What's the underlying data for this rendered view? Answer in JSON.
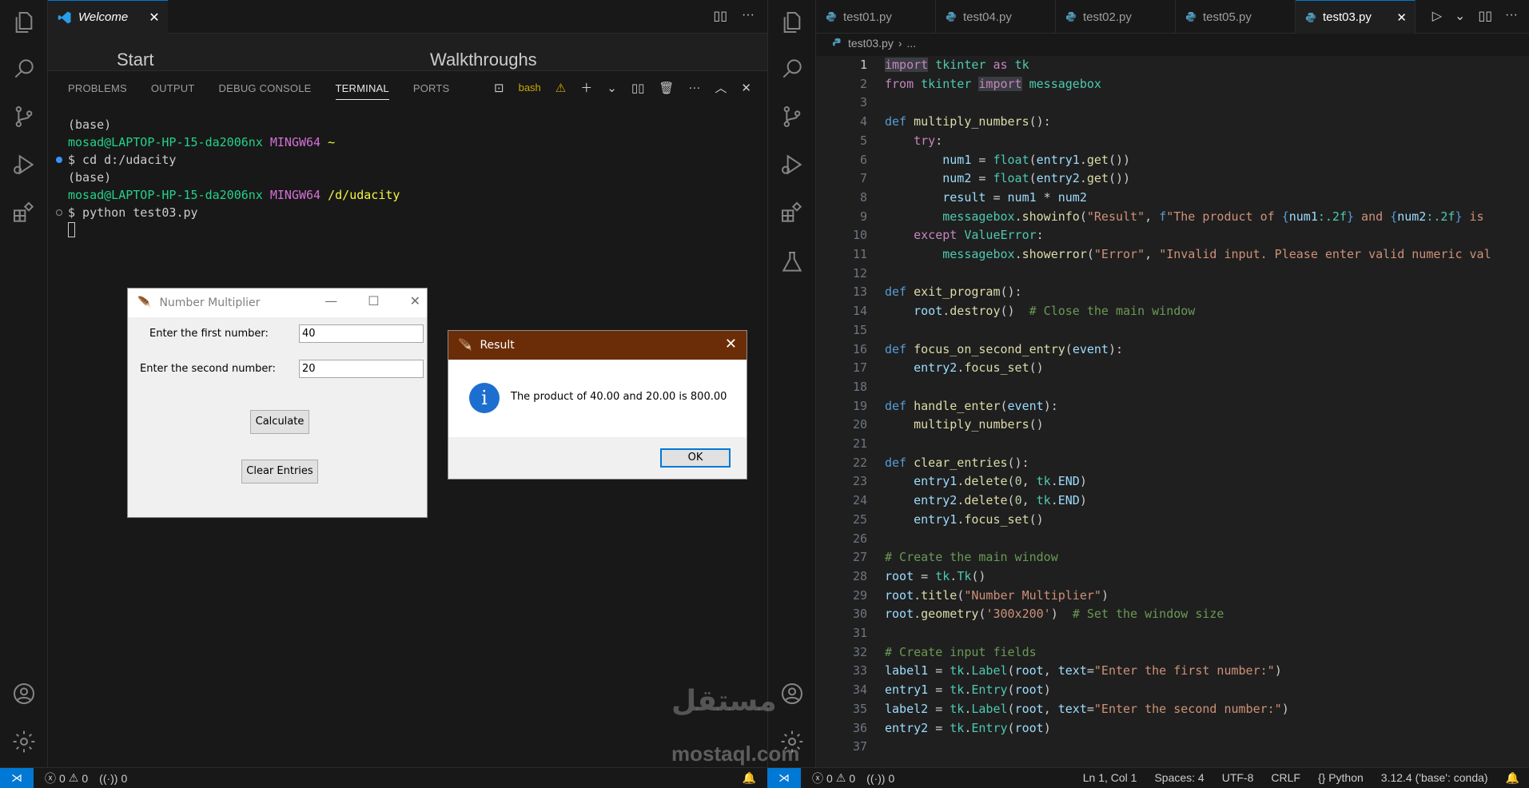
{
  "left_window": {
    "tab": {
      "title": "Welcome",
      "close": "✕"
    },
    "welcome": {
      "start": "Start",
      "walkthroughs": "Walkthroughs"
    },
    "panel": {
      "tabs": [
        "PROBLEMS",
        "OUTPUT",
        "DEBUG CONSOLE",
        "TERMINAL",
        "PORTS"
      ],
      "active_tab": "TERMINAL",
      "shell_label": "bash"
    },
    "terminal": {
      "l1": "(base)",
      "l2_user": "mosad@LAPTOP-HP-15-da2006nx",
      "l2_env": "MINGW64",
      "l2_path": "~",
      "l3": "$ cd d:/udacity",
      "l4": "(base)",
      "l5_user": "mosad@LAPTOP-HP-15-da2006nx",
      "l5_env": "MINGW64",
      "l5_path": "/d/udacity",
      "l6": "$ python test03.py"
    }
  },
  "tk_main": {
    "title": "Number Multiplier",
    "label1": "Enter the first number:",
    "entry1": "40",
    "label2": "Enter the second number:",
    "entry2": "20",
    "calculate": "Calculate",
    "clear": "Clear Entries"
  },
  "tk_result": {
    "title": "Result",
    "message": "The product of 40.00 and 20.00 is 800.00",
    "ok": "OK"
  },
  "right_window": {
    "tabs": [
      "test01.py",
      "test04.py",
      "test02.py",
      "test05.py",
      "test03.py"
    ],
    "active_tab": "test03.py",
    "breadcrumb": {
      "file": "test03.py",
      "rest": "..."
    }
  },
  "status_left": {
    "errors": "0",
    "warnings": "0",
    "ports": "0"
  },
  "status_right": {
    "errors": "0",
    "warnings": "0",
    "ports": "0",
    "position": "Ln 1, Col 1",
    "spaces": "Spaces: 4",
    "encoding": "UTF-8",
    "eol": "CRLF",
    "language": "Python",
    "interpreter": "3.12.4 ('base': conda)"
  },
  "watermark": {
    "arabic": "مستقل",
    "latin": "mostaql.com"
  },
  "colors": {
    "accent": "#0078d4",
    "result_titlebar": "#6b2d08",
    "info_icon": "#1d6fcf"
  }
}
